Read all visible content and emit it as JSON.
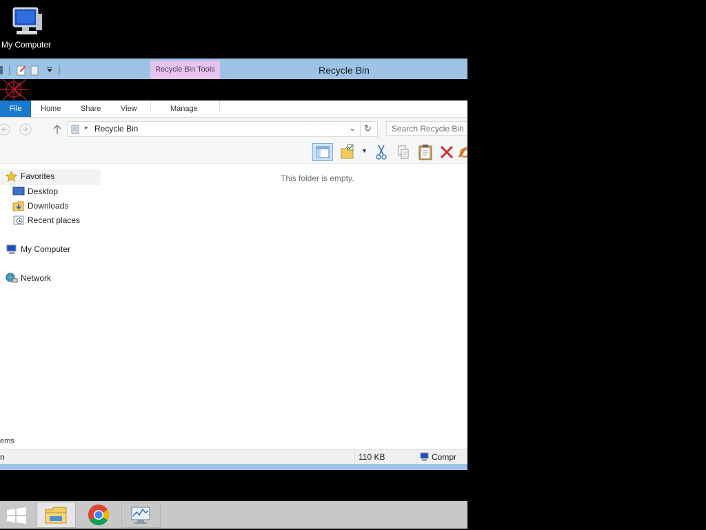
{
  "desktop": {
    "icon_label": "My Computer"
  },
  "window": {
    "title": "Recycle Bin",
    "context_tab": "Recycle Bin Tools",
    "ribbon_tabs": [
      "File",
      "Home",
      "Share",
      "View",
      "Manage"
    ],
    "address": "Recycle Bin",
    "search_placeholder": "Search Recycle Bin",
    "empty_message": "This folder is empty.",
    "nav": {
      "favorites": "Favorites",
      "favorites_items": [
        "Desktop",
        "Downloads",
        "Recent places"
      ],
      "computer": "My Computer",
      "network": "Network"
    },
    "status": {
      "items_text": "ems",
      "left_text": "n",
      "size": "110 KB",
      "computer_label": "Compr"
    }
  },
  "colors": {
    "title_bar": "#9dc3e6",
    "context_tab": "#e6c4ee",
    "file_tab": "#1979ca",
    "taskbar": "#c8c8c8"
  }
}
